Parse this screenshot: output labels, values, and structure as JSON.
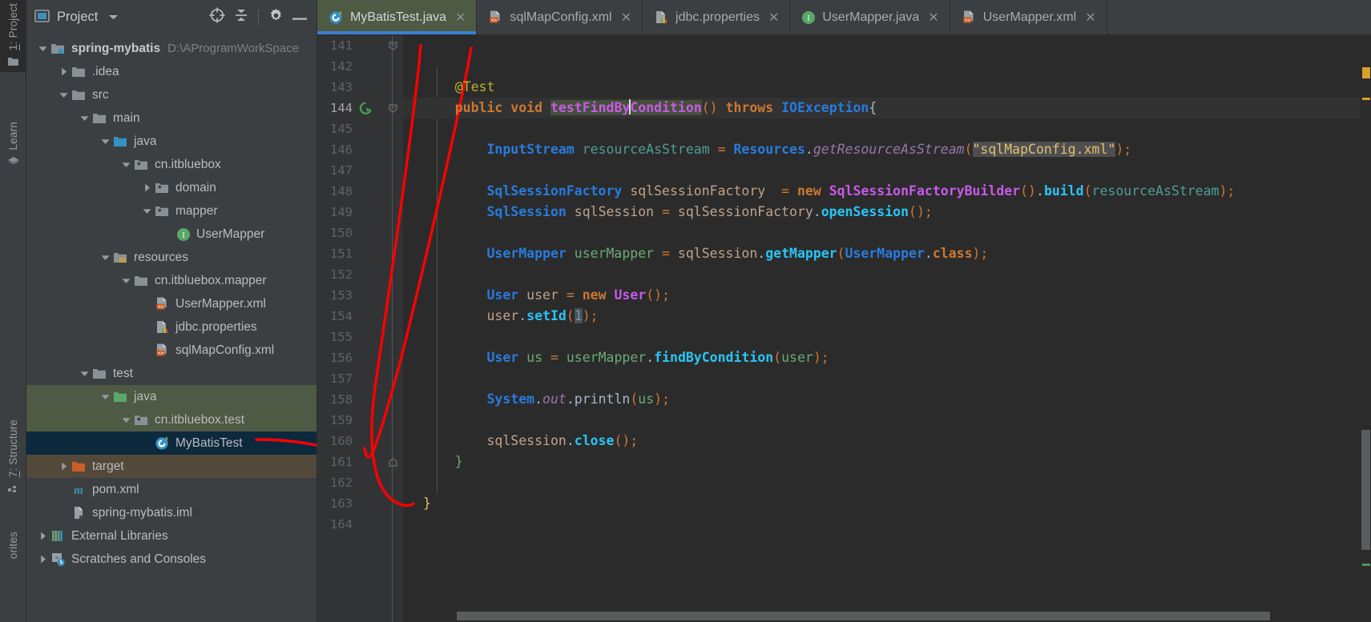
{
  "toolstripe": {
    "items": [
      {
        "label": "1: Project",
        "icon": "folder-icon",
        "active": true
      },
      {
        "label": "Learn",
        "icon": "graduation-cap-icon",
        "active": false
      },
      {
        "label": "7: Structure",
        "icon": "structure-icon",
        "active": false
      },
      {
        "label": "orites",
        "icon": "favorites-icon",
        "active": false
      }
    ]
  },
  "project_panel": {
    "title": "Project",
    "title_icon": "project-view-icon",
    "chevron_icon": "chevron-down-icon",
    "toolbar_buttons": [
      {
        "name": "select-opened-file-button",
        "icon": "crosshair-icon"
      },
      {
        "name": "collapse-all-button",
        "icon": "collapse-all-icon"
      },
      {
        "name": "settings-button",
        "icon": "gear-icon"
      },
      {
        "name": "hide-button",
        "icon": "minimize-icon"
      }
    ],
    "tree": [
      {
        "label": "spring-mybatis",
        "path": "D:\\AProgramWorkSpace",
        "depth": 0,
        "arrow": "down",
        "icon": "module-folder-icon",
        "bold": true,
        "highlight": "none"
      },
      {
        "label": ".idea",
        "path": "",
        "depth": 1,
        "arrow": "right",
        "icon": "folder-icon",
        "bold": false,
        "highlight": "none"
      },
      {
        "label": "src",
        "path": "",
        "depth": 1,
        "arrow": "down",
        "icon": "folder-icon",
        "bold": false,
        "highlight": "none"
      },
      {
        "label": "main",
        "path": "",
        "depth": 2,
        "arrow": "down",
        "icon": "folder-icon",
        "bold": false,
        "highlight": "none"
      },
      {
        "label": "java",
        "path": "",
        "depth": 3,
        "arrow": "down",
        "icon": "source-root-icon",
        "bold": false,
        "highlight": "none"
      },
      {
        "label": "cn.itbluebox",
        "path": "",
        "depth": 4,
        "arrow": "down",
        "icon": "package-icon",
        "bold": false,
        "highlight": "none"
      },
      {
        "label": "domain",
        "path": "",
        "depth": 5,
        "arrow": "right",
        "icon": "package-icon",
        "bold": false,
        "highlight": "none"
      },
      {
        "label": "mapper",
        "path": "",
        "depth": 5,
        "arrow": "down",
        "icon": "package-icon",
        "bold": false,
        "highlight": "none"
      },
      {
        "label": "UserMapper",
        "path": "",
        "depth": 6,
        "arrow": "none",
        "icon": "interface-icon",
        "bold": false,
        "highlight": "none"
      },
      {
        "label": "resources",
        "path": "",
        "depth": 3,
        "arrow": "down",
        "icon": "resource-root-icon",
        "bold": false,
        "highlight": "none"
      },
      {
        "label": "cn.itbluebox.mapper",
        "path": "",
        "depth": 4,
        "arrow": "down",
        "icon": "folder-icon",
        "bold": false,
        "highlight": "none"
      },
      {
        "label": "UserMapper.xml",
        "path": "",
        "depth": 5,
        "arrow": "none",
        "icon": "xml-file-icon",
        "bold": false,
        "highlight": "none"
      },
      {
        "label": "jdbc.properties",
        "path": "",
        "depth": 5,
        "arrow": "none",
        "icon": "properties-file-icon",
        "bold": false,
        "highlight": "none"
      },
      {
        "label": "sqlMapConfig.xml",
        "path": "",
        "depth": 5,
        "arrow": "none",
        "icon": "xml-file-icon",
        "bold": false,
        "highlight": "none"
      },
      {
        "label": "test",
        "path": "",
        "depth": 2,
        "arrow": "down",
        "icon": "folder-icon",
        "bold": false,
        "highlight": "none"
      },
      {
        "label": "java",
        "path": "",
        "depth": 3,
        "arrow": "down",
        "icon": "test-source-root-icon",
        "bold": false,
        "highlight": "green"
      },
      {
        "label": "cn.itbluebox.test",
        "path": "",
        "depth": 4,
        "arrow": "down",
        "icon": "package-icon",
        "bold": false,
        "highlight": "green"
      },
      {
        "label": "MyBatisTest",
        "path": "",
        "depth": 5,
        "arrow": "none",
        "icon": "java-test-class-icon",
        "bold": false,
        "highlight": "blue"
      },
      {
        "label": "target",
        "path": "",
        "depth": 1,
        "arrow": "right",
        "icon": "excluded-folder-icon",
        "bold": false,
        "highlight": "brown"
      },
      {
        "label": "pom.xml",
        "path": "",
        "depth": 1,
        "arrow": "none",
        "icon": "maven-icon",
        "bold": false,
        "highlight": "none"
      },
      {
        "label": "spring-mybatis.iml",
        "path": "",
        "depth": 1,
        "arrow": "none",
        "icon": "iml-file-icon",
        "bold": false,
        "highlight": "none"
      },
      {
        "label": "External Libraries",
        "path": "",
        "depth": 0,
        "arrow": "right",
        "icon": "libraries-icon",
        "bold": false,
        "highlight": "none"
      },
      {
        "label": "Scratches and Consoles",
        "path": "",
        "depth": 0,
        "arrow": "right",
        "icon": "scratches-icon",
        "bold": false,
        "highlight": "none"
      }
    ]
  },
  "editor": {
    "tabs": [
      {
        "label": "MyBatisTest.java",
        "icon": "java-test-class-icon",
        "active": true,
        "close_icon": "close-icon"
      },
      {
        "label": "sqlMapConfig.xml",
        "icon": "xml-file-icon",
        "active": false,
        "close_icon": "close-icon"
      },
      {
        "label": "jdbc.properties",
        "icon": "properties-file-icon",
        "active": false,
        "close_icon": "close-icon"
      },
      {
        "label": "UserMapper.java",
        "icon": "interface-icon",
        "active": false,
        "close_icon": "close-icon"
      },
      {
        "label": "UserMapper.xml",
        "icon": "xml-file-icon",
        "active": false,
        "close_icon": "close-icon"
      }
    ],
    "first_line_number": 141,
    "last_line_number": 164,
    "current_line": 144,
    "run_gutter_line": 144,
    "line_numbers": [
      "141",
      "142",
      "143",
      "144",
      "145",
      "146",
      "147",
      "148",
      "149",
      "150",
      "151",
      "152",
      "153",
      "154",
      "155",
      "156",
      "157",
      "158",
      "159",
      "160",
      "161",
      "162",
      "163",
      "164"
    ],
    "code_lines": [
      "",
      "",
      "    @Test",
      "    public void testFindByCondition() throws IOException{",
      "",
      "        InputStream resourceAsStream = Resources.getResourceAsStream(\"sqlMapConfig.xml\");",
      "",
      "        SqlSessionFactory sqlSessionFactory  = new SqlSessionFactoryBuilder().build(resourceAsStream);",
      "        SqlSession sqlSession = sqlSessionFactory.openSession();",
      "",
      "        UserMapper userMapper = sqlSession.getMapper(UserMapper.class);",
      "",
      "        User user = new User();",
      "        user.setId(1);",
      "",
      "        User us = userMapper.findByCondition(user);",
      "",
      "        System.out.println(us);",
      "",
      "        sqlSession.close();",
      "    }",
      "",
      "}",
      ""
    ],
    "method_name": "testFindByCondition",
    "string_literal": "\"sqlMapConfig.xml\"",
    "numeric_literal": "1"
  },
  "colors": {
    "accent_tab_underline": "#3c7fd4",
    "selection_blue": "#0d293e",
    "test_root_green": "#4e5a44",
    "excluded_brown": "#53493a",
    "annotation_red": "#fe0000",
    "editor_bg": "#2b2b2b",
    "panel_bg": "#3c3f41",
    "gutter_bg": "#313335"
  }
}
